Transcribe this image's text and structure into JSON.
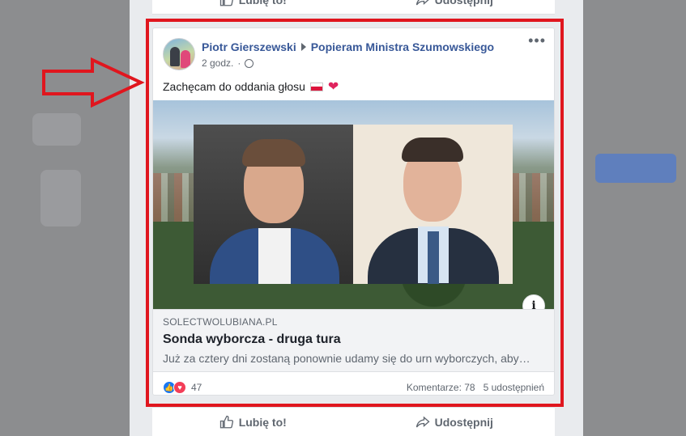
{
  "post": {
    "author": "Piotr Gierszewski",
    "group": "Popieram Ministra Szumowskiego",
    "time": "2 godz.",
    "text": "Zachęcam do oddania głosu",
    "more_icon": "•••"
  },
  "link_preview": {
    "domain": "SOLECTWOLUBIANA.PL",
    "title": "Sonda wyborcza - druga tura",
    "description": "Już za cztery dni zostaną ponownie udamy się do urn wyborczych, aby…",
    "info_icon": "i"
  },
  "stats": {
    "reactions_count": "47",
    "comments": "Komentarze: 78",
    "shares": "5 udostępnień"
  },
  "actions": {
    "like": "Lubię to!",
    "share": "Udostępnij"
  },
  "colors": {
    "highlight": "#e0161e",
    "link": "#385898"
  }
}
